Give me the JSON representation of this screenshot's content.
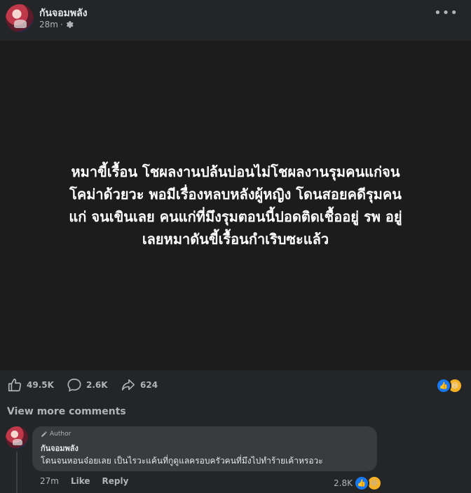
{
  "post": {
    "page_name": "กันจอมพลัง",
    "time": "28m",
    "separator": "·",
    "body_lines": [
      "หมาขี้เรื้อน โชผลงานปล้นบ่อนไม่โชผลงานรุมคนแก่จน",
      "โคม่าด้วยวะ พอมีเรื่องหลบหลังผู้หญิง โดนสอยคดีรุมคน",
      "แก่ จนเขินเลย คนแก่ที่มึงรุมตอนนี้ปอดติดเชื้ออยู่ รพ อยู่",
      "เลยหมาดันขี้เรื้อนกำเริบซะแล้ว"
    ]
  },
  "actions": {
    "likes": "49.5K",
    "comments": "2.6K",
    "shares": "624"
  },
  "comments_section": {
    "view_more": "View more comments",
    "comment": {
      "badge": "Author",
      "author": "กันจอมพลัง",
      "text": "โดนจนหอนจ๋อยเลย เป็นไรวะแค้นที่กูดูแลครอบครัวคนที่มึงไปทำร้ายเค้าหรอวะ",
      "time": "27m",
      "like_label": "Like",
      "reply_label": "Reply",
      "reaction_count": "2.8K"
    }
  },
  "icons": {
    "more": "more-horizontal-icon",
    "audience": "gear-icon",
    "like": "thumbs-up-icon",
    "comment": "speech-bubble-icon",
    "share": "share-arrow-icon",
    "reaction_like": "like-reaction-icon",
    "reaction_haha": "haha-reaction-icon",
    "author_badge": "pencil-icon"
  },
  "colors": {
    "background": "#242526",
    "post_image_bg": "#1c1c1d",
    "bubble": "#3a3b3c",
    "secondary_text": "#b0b3b8",
    "like_blue": "#1877f2",
    "haha_yellow": "#f7b125"
  }
}
